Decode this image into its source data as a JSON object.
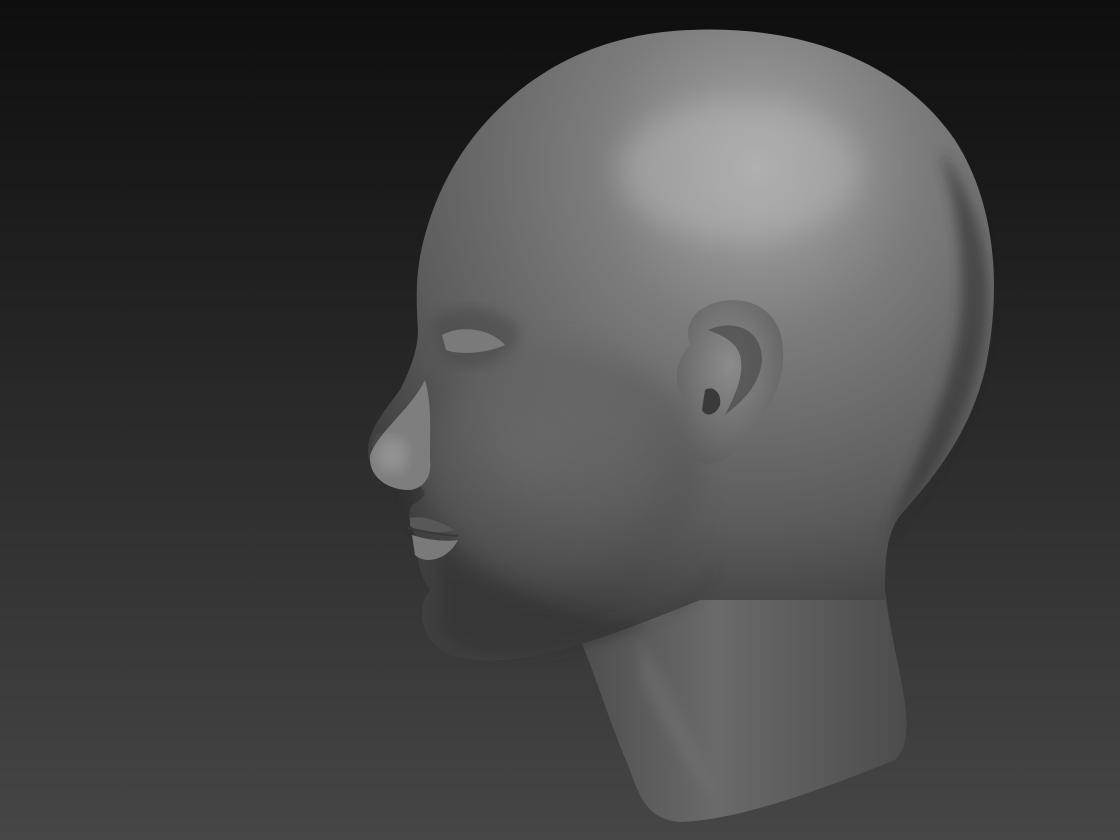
{
  "viewport": {
    "background_top": "#0f0f0f",
    "background_bottom": "#454545",
    "model": {
      "name": "head-sculpt",
      "material_base": "#6f6f6f",
      "material_highlight": "#a6a6a6",
      "material_shadow": "#3c3c3c"
    }
  }
}
